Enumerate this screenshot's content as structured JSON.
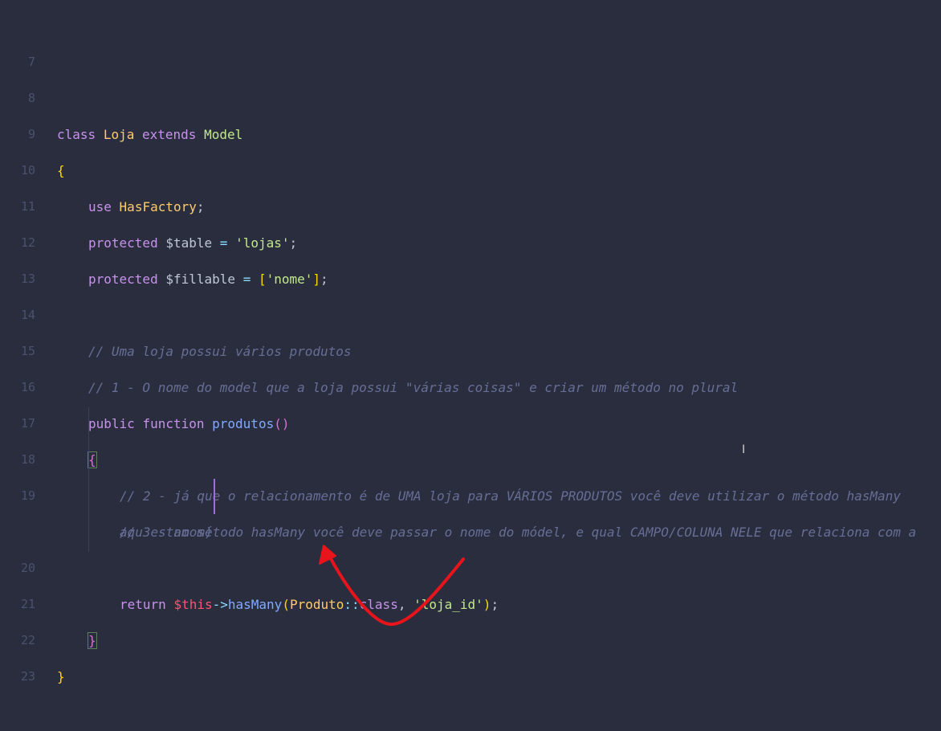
{
  "lines": [
    {
      "num": "7"
    },
    {
      "num": "8",
      "t": [
        "class",
        "Loja",
        "extends",
        "Model"
      ]
    },
    {
      "num": "9",
      "t": [
        "{"
      ]
    },
    {
      "num": "10",
      "t": [
        "use",
        "HasFactory",
        ";"
      ]
    },
    {
      "num": "11",
      "t": [
        "protected",
        "$table",
        "=",
        "'lojas'",
        ";"
      ]
    },
    {
      "num": "12",
      "t": [
        "protected",
        "$fillable",
        "=",
        "[",
        "'nome'",
        "]",
        ";"
      ]
    },
    {
      "num": "13"
    },
    {
      "num": "14",
      "t": [
        "// Uma loja possui vários produtos"
      ]
    },
    {
      "num": "15",
      "t": [
        "// 1 - O nome do model que a loja possui \"várias coisas\" e criar um método no plural"
      ]
    },
    {
      "num": "16",
      "t": [
        "public",
        "function",
        "produtos",
        "()"
      ]
    },
    {
      "num": "17",
      "t": [
        "{"
      ]
    },
    {
      "num": "18",
      "t": [
        "// 2 - já que o relacionamento é de UMA loja para VÁRIOS PRODUTOS você deve utilizar o método hasMany"
      ]
    },
    {
      "num": "19",
      "t": [
        "// 3 - no método hasMany você deve passar o nome do módel, e qual CAMPO/COLUNA NELE que relaciona com a",
        "aqu estamos)"
      ]
    },
    {
      "num": "20",
      "t": [
        "return",
        "$this",
        "->",
        "hasMany",
        "(",
        "Produto",
        "::",
        "class",
        ", ",
        "'loja_id'",
        ")",
        ";"
      ]
    },
    {
      "num": "21",
      "t": [
        "}"
      ]
    },
    {
      "num": "22",
      "t": [
        "}"
      ]
    },
    {
      "num": "23"
    }
  ],
  "annotation": {
    "color": "#e8141b"
  }
}
